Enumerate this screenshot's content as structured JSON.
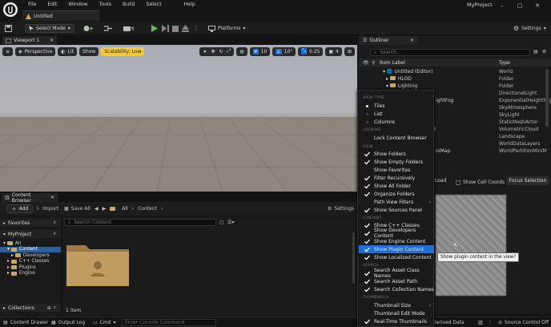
{
  "app": {
    "project": "MyProject",
    "document_tab": "Untitled"
  },
  "menubar": [
    "File",
    "Edit",
    "Window",
    "Tools",
    "Build",
    "Select",
    "Help"
  ],
  "toolbar": {
    "select_mode": "Select Mode",
    "platforms": "Platforms",
    "settings": "Settings"
  },
  "viewport": {
    "tab": "Viewport 1",
    "perspective": "Perspective",
    "lit": "Lit",
    "show": "Show",
    "scalability": "Scalability: Low",
    "grid": "10",
    "angle": "10°",
    "scale": "0.25",
    "camera": "4"
  },
  "outliner": {
    "tab": "Outliner",
    "search_placeholder": "Search...",
    "col_label": "Item Label",
    "col_type": "Type",
    "rows": [
      {
        "label": "Untitled (Editor)",
        "type": "World"
      },
      {
        "label": "HLOD",
        "type": "Folder"
      },
      {
        "label": "Lighting",
        "type": "Folder"
      },
      {
        "label": "",
        "type": "DirectionalLight"
      },
      {
        "label": "ightFog",
        "type": "ExponentialHeightFog"
      },
      {
        "label": "",
        "type": "SkyAtmosphere"
      },
      {
        "label": "",
        "type": "SkyLight"
      },
      {
        "label": "",
        "type": "StaticMeshActor"
      },
      {
        "label": "d",
        "type": "VolumetricCloud"
      },
      {
        "label": "",
        "type": "Landscape"
      },
      {
        "label": "",
        "type": "WorldDataLayers"
      },
      {
        "label": "niMap",
        "type": "WorldPartitionMiniM"
      }
    ]
  },
  "worldpartition": {
    "load": "Load",
    "show_cell_coords": "Show Cell Coords",
    "focus_selection": "Focus Selection",
    "tooltip": "Show plugin content in the view?"
  },
  "content_browser": {
    "tab": "Content Browser",
    "add": "Add",
    "import": "Import",
    "save_all": "Save All",
    "path_all": "All",
    "path_content": "Content",
    "settings": "Settings",
    "search_placeholder": "Search Content",
    "favorites": "Favorites",
    "project": "MyProject",
    "collections": "Collections",
    "item_count": "1 item",
    "tree": [
      "All",
      "Content",
      "Developers",
      "C++ Classes",
      "Plugins",
      "Engine"
    ]
  },
  "status": {
    "drawer": "Content Drawer",
    "output_log": "Output Log",
    "cmd": "Cmd",
    "console_placeholder": "Enter Console Command",
    "derived": "Derived Data",
    "source_control": "Source Control Off"
  },
  "menu": {
    "sections": [
      "VIEW TYPE",
      "LOCKING",
      "VIEW",
      "CONTENT",
      "SEARCH",
      "THUMBNAILS"
    ],
    "view_type": [
      "Tiles",
      "List",
      "Columns"
    ],
    "locking": [
      "Lock Content Browser"
    ],
    "view": [
      "Show Folders",
      "Show Empty Folders",
      "Show Favorites",
      "Filter Recursively",
      "Show All Folder",
      "Organize Folders",
      "Path View Filters",
      "Show Sources Panel"
    ],
    "content": [
      "Show C++ Classes",
      "Show Developers Content",
      "Show Engine Content",
      "Show Plugin Content",
      "Show Localized Content"
    ],
    "search": [
      "Search Asset Class Names",
      "Search Asset Path",
      "Search Collection Names"
    ],
    "thumbnails": [
      "Thumbnail Size",
      "Thumbnail Edit Mode",
      "Real-Time Thumbnails"
    ]
  },
  "colors": {
    "accent": "#1f6fd6",
    "scalability": "#f0c93d",
    "folder": "#c9a66b",
    "play": "#5fbf4f"
  }
}
